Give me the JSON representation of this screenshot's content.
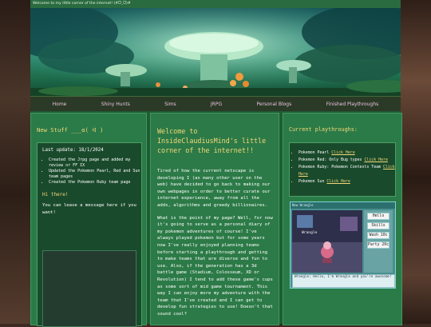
{
  "site": {
    "topbar_title": "Welcome to my little corner of the internet! (#ᗜˬᗜ)#"
  },
  "nav": [
    {
      "label": "Home"
    },
    {
      "label": "Shiny Hunts"
    },
    {
      "label": "Sims"
    },
    {
      "label": "JRPG"
    },
    {
      "label": "Personal Blogs"
    },
    {
      "label": "Finished Playthroughs"
    }
  ],
  "left": {
    "title": "New Stuff ___α( ᐛ )",
    "last_update": "Last update: 18/1/2024",
    "updates": [
      "Created the Jrpg page and added my review or FF IX",
      "Updated the Pokemon Pearl, Red and Sun team pages",
      "Created the Pokemon Ruby team page"
    ],
    "hi": "Hi there!",
    "message": "You can leave a message here if you want!"
  },
  "middle": {
    "title": "Welcome to InsideClaudiusMind's little corner of the internet!!",
    "paragraphs": [
      "Tired of how the current netscape is developing I (as many other user on the web) have decided to go back to making our own webpages in order to better curate our internet experience, away from all the adds, algorithms and greedy billionaires.",
      "What is the point of my page? Well, for now it's going to serve as a personal diary of my pokemon adventures of course! I've always played pokemon but for some years now I've really enjoyed planning teams before starting a playthrough and getting to make teams that are diverse and fun to use. Also, if the generation has a 3d battle game (Stadium, Colosseum, XD or Revolution) I tend to add these game's cups as some sort of mid game tournament. This way I can enjoy more my adventure with the team that I've created and I can get to develop fun strategies to use! Doesn't that sound cool?"
    ]
  },
  "right": {
    "title": "Current playthroughs:",
    "items": [
      {
        "text": "Pokemon Pearl",
        "link": "Click Here"
      },
      {
        "text": "Pokemon Red: Only Bug types",
        "link": "Click Here"
      },
      {
        "text": "Pokemon Ruby: Pokemon Contests Team",
        "link": "Click Here"
      },
      {
        "text": "Pokemon Sun",
        "link": "Click Here"
      }
    ],
    "game": {
      "top": "New Wrangle",
      "label": "Wrangle",
      "menu": [
        "Hello",
        "Skills",
        "Wash 10c",
        "Party 20c"
      ],
      "dialog": "Wrangle: Hello, I'm Wrangle and you're awesome!"
    }
  }
}
